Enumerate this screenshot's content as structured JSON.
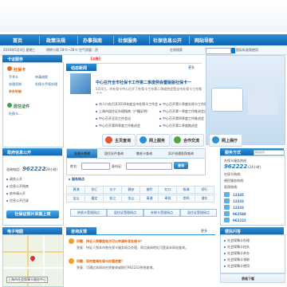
{
  "nav": {
    "items": [
      "首页",
      "政策法规",
      "办事指南",
      "社保服务",
      "社保信息公开",
      "网站导航"
    ]
  },
  "infobar": {
    "date": "2016年5月4日 星期三",
    "weather": "阴转小雨 18℃~26℃ 空气质量：良",
    "hotline_label": "热线电话",
    "search_label": "在线搜索",
    "tip": "国际标准版使用"
  },
  "card_section": {
    "title": "卡证服务",
    "items": [
      "社保卡",
      "手术卡",
      "申请流程",
      "办理须知",
      "社保卡手续办理",
      "补办补缺"
    ],
    "extra": [
      "居住证件",
      "社保卡..."
    ]
  },
  "news": {
    "tag": "[公告]",
    "header": "动态新闻",
    "more": "更多",
    "headline": "中心召开全市社保卡工作第二季度例会暨版版社保卡一",
    "summary": "5月4日，市社保卡中心召开了社保卡工作第二季度例会暨全市社保卡工作推进会...",
    "items_left": [
      "市人口办召开2016年度全市社保卡工作会",
      "上海市居住证办理指南（户籍证明）",
      "中心召开全员工作会议",
      "中心召开第四季度工作推进会"
    ],
    "items_right": [
      "中心召开第二季度社保卡工作例会",
      "中心召开第一季度工作推进会议",
      "中心召开第四季度工作推进会",
      "中心召开第二季度推进会"
    ]
  },
  "quick_links": {
    "query": "主页查询",
    "service": "网上服务",
    "cooperate": "合作交流",
    "hall": "网上展厅"
  },
  "service_center": {
    "title": "政府信息公开",
    "phone_label": "咨询电话:",
    "phone": "962222",
    "note": "(24小时)",
    "items": [
      "政务公开",
      "信息公开指南",
      "依申请公开",
      "信息公开目录"
    ],
    "photo_btn": "社保证照片采集上岗"
  },
  "tabs": {
    "items": [
      "社保卡查询",
      "居住证件查询",
      "敬老卡查询",
      "异沪流通医保查询"
    ]
  },
  "query_form": {
    "name_label": "姓名:",
    "id_label": "身份证:",
    "submit": "查询",
    "hint": "社保卡服务网点查询"
  },
  "district": {
    "title": "服务网点",
    "rows": [
      [
        "黄浦",
        "徐汇",
        "长宁",
        "静安",
        "普陀",
        "虹口",
        "杨浦",
        "闵行"
      ],
      [
        "宝山",
        "嘉定",
        "松江",
        "金山",
        "青浦",
        "奉贤",
        "崇明",
        "浦东"
      ]
    ],
    "buttons": [
      "补换卡受理网点",
      "居住证受理网点",
      "补换卡受理网点",
      "居住证受理网点"
    ]
  },
  "right_panel": {
    "title": "服务方式",
    "search_placeholder": "网站搜索",
    "phone_label": "社保卡服务热线",
    "phone": "962222",
    "phone_note": "(24小时)",
    "lines": [
      "社保卡热线:",
      "便民服务热线:",
      "医保热线:"
    ],
    "codes": [
      "12345",
      "12333",
      "12333",
      "962548",
      "962222"
    ]
  },
  "bottom": {
    "map_title": "电子地图",
    "map_caption": "上海市社会保障卡服务中心",
    "faq_title": "咨询反馈",
    "faq_more": "更多",
    "faq_q1": "问题：持证人到哪些地方可以申请补发社保卡？",
    "faq_a1": "答复：持证人到本市各社保卡服务网点办理，网点具体地址可登录本网站查询。",
    "faq_q2": "问题：如何查询社保卡办理进度？",
    "faq_a2": "答复：可通过本网站在线查询或拨打962222热线查询。",
    "dl_title": "便民问答",
    "dl_items": [
      "社会保障卡办理",
      "社会保障卡挂失",
      "社会保障卡补办",
      "社会保障卡领取",
      "社会保障卡使用"
    ],
    "table_title": "表格下载"
  }
}
